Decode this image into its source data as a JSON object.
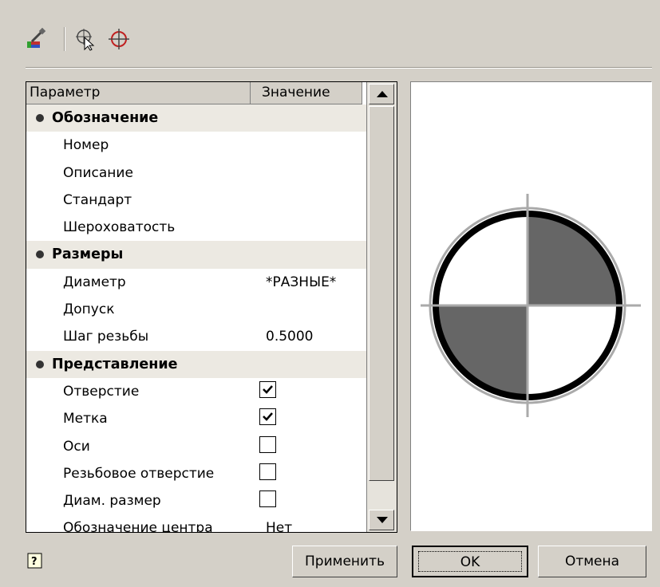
{
  "toolbar": {
    "buttons": [
      "paint-brush-icon",
      "select-object-icon",
      "pick-point-icon"
    ]
  },
  "grid": {
    "columns": [
      "Параметр",
      "Значение"
    ],
    "categories": [
      {
        "name": "Обозначение",
        "rows": [
          {
            "label": "Номер",
            "value": ""
          },
          {
            "label": "Описание",
            "value": ""
          },
          {
            "label": "Стандарт",
            "value": ""
          },
          {
            "label": "Шероховатость",
            "value": ""
          }
        ]
      },
      {
        "name": "Размеры",
        "rows": [
          {
            "label": "Диаметр",
            "value": "*РАЗНЫЕ*"
          },
          {
            "label": "Допуск",
            "value": ""
          },
          {
            "label": "Шаг резьбы",
            "value": "0.5000"
          }
        ]
      },
      {
        "name": "Представление",
        "rows": [
          {
            "label": "Отверстие",
            "checked": true
          },
          {
            "label": "Метка",
            "checked": true
          },
          {
            "label": "Оси",
            "checked": false
          },
          {
            "label": "Резьбовое отверстие",
            "checked": false
          },
          {
            "label": "Диам. размер",
            "checked": false
          },
          {
            "label": "Обозначение центра",
            "value": "Нет"
          }
        ]
      }
    ]
  },
  "preview": {
    "symbol": "center-mark-symbol",
    "fill_color": "#666666"
  },
  "buttons": {
    "apply": "Применить",
    "ok": "OK",
    "cancel": "Отмена",
    "help_icon": "help-icon"
  }
}
